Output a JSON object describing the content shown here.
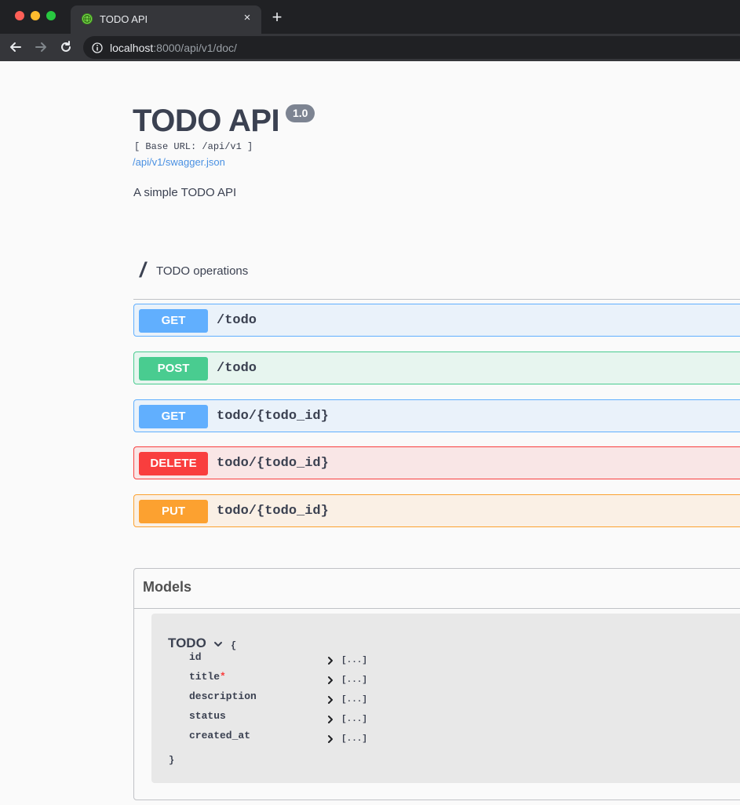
{
  "browser": {
    "tab_title": "TODO API",
    "tab_close": "×",
    "new_tab": "+",
    "url_host": "localhost",
    "url_rest": ":8000/api/v1/doc/"
  },
  "info": {
    "title": "TODO API",
    "version": "1.0",
    "base_url": "[ Base URL: /api/v1 ]",
    "spec_link": "/api/v1/swagger.json",
    "description": "A simple TODO API"
  },
  "tag": {
    "name": "/",
    "description": "TODO operations"
  },
  "operations": [
    {
      "method": "GET",
      "path": "/todo"
    },
    {
      "method": "POST",
      "path": "/todo"
    },
    {
      "method": "GET",
      "path": "todo/{todo_id}"
    },
    {
      "method": "DELETE",
      "path": "todo/{todo_id}"
    },
    {
      "method": "PUT",
      "path": "todo/{todo_id}"
    }
  ],
  "models": {
    "title": "Models",
    "model": {
      "name": "TODO",
      "open_brace": "{",
      "close_brace": "}",
      "properties": [
        {
          "name": "id",
          "required": "",
          "collapsed": "[...]"
        },
        {
          "name": "title",
          "required": "*",
          "collapsed": "[...]"
        },
        {
          "name": "description",
          "required": "",
          "collapsed": "[...]"
        },
        {
          "name": "status",
          "required": "",
          "collapsed": "[...]"
        },
        {
          "name": "created_at",
          "required": "",
          "collapsed": "[...]"
        }
      ]
    }
  },
  "colors": {
    "get": "#61affe",
    "post": "#49cc90",
    "delete": "#f93e3e",
    "put": "#fca130",
    "text": "#3b4151"
  }
}
